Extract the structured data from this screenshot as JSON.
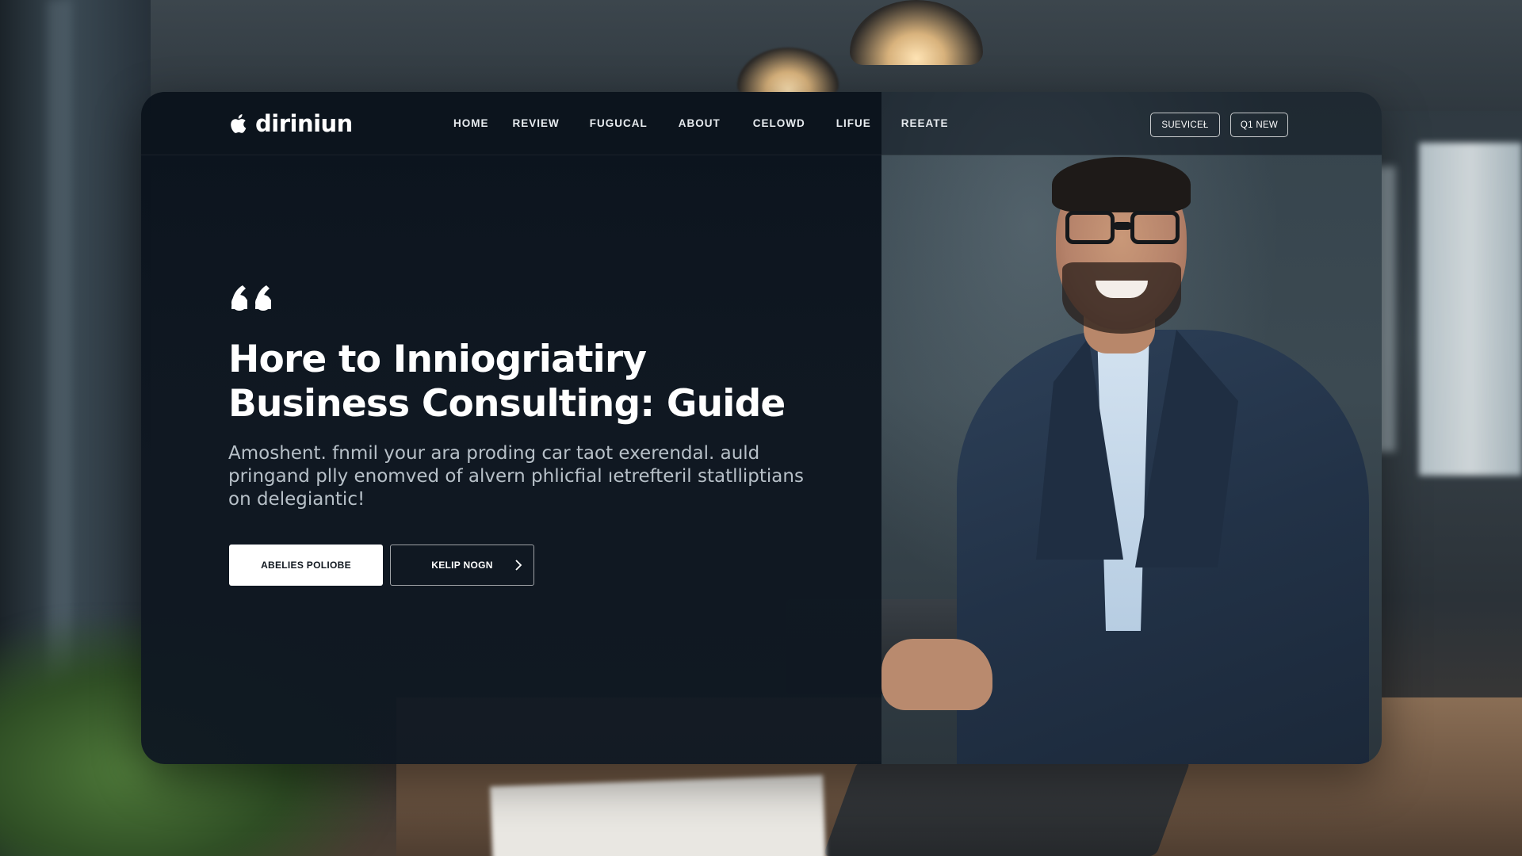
{
  "brand": {
    "logo_icon": "apple-icon",
    "name": "diriniun"
  },
  "nav": {
    "items": [
      {
        "label": "HOME"
      },
      {
        "label": "REVIEW"
      },
      {
        "label": "FUGUCAL"
      },
      {
        "label": "ABOUT"
      },
      {
        "label": "CELOWD"
      },
      {
        "label": "LIFUE"
      },
      {
        "label": "REEATE"
      }
    ]
  },
  "header_buttons": {
    "services_label": "SUEVICEŁ",
    "new_label": "Q1 NEW"
  },
  "hero": {
    "quote_icon": "quote-icon",
    "title": "Hore to Inniogriatiry Business Consulting: Guide",
    "body": "Amoshent. fnmil your ara proding car taot exerendal. auld pringand plly enomved of alvern phlicfial ıetrefteril statlliptians on delegiantic!",
    "primary_cta": "ABELIES POLIOBE",
    "secondary_cta": "KELIP NOGN",
    "secondary_cta_icon": "chevron-right-icon"
  },
  "colors": {
    "panel": "#0e1620",
    "text_primary": "#ffffff",
    "text_muted": "#b7c0c8",
    "button_primary_bg": "#ffffff"
  }
}
